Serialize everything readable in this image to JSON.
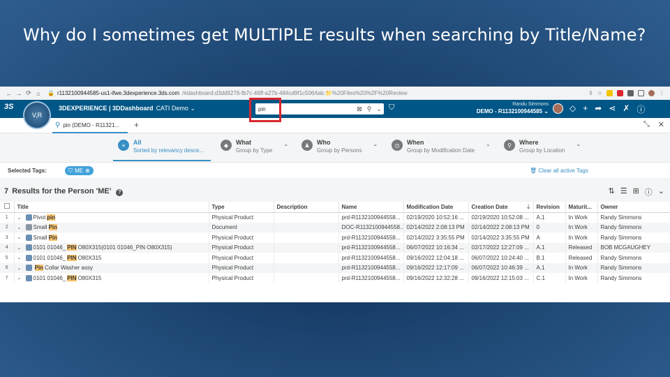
{
  "slide": {
    "title": "Why do I sometimes get MULTIPLE results when searching by Title/Name?"
  },
  "browser": {
    "back": "←",
    "forward": "→",
    "reload": "⟳",
    "home": "⌂",
    "url_host": "r1132100944585-us1-ifwe.3dexperience.3ds.com",
    "url_path": "/#dashboard:d3dd9276-fb7c-46ff-a27b-484cd9f1c506/tab:📁%20Files%20%2F%20Review"
  },
  "topbar": {
    "ds_logo": "3S",
    "compass_label": "V,R",
    "brand": "3DEXPERIENCE | 3DDashboard",
    "dashboard": "CATI Demo ⌄",
    "search_value": "pin",
    "user_name": "Randu Simmons",
    "tenant": "DEMO - R1132100944585 ⌄"
  },
  "tabs": {
    "active_label": "pin (DEMO - R11321...",
    "add": "+"
  },
  "filters": [
    {
      "main": "All",
      "sub": "Sorted by relevancy desce...",
      "icon": "≡"
    },
    {
      "main": "What",
      "sub": "Group by Type",
      "icon": "◆"
    },
    {
      "main": "Who",
      "sub": "Group by Persons",
      "icon": "♟"
    },
    {
      "main": "When",
      "sub": "Group by Modification Date",
      "icon": "◷"
    },
    {
      "main": "Where",
      "sub": "Group by Location",
      "icon": "⚲"
    }
  ],
  "tags": {
    "label": "Selected Tags:",
    "chip": "ME",
    "clear": "Clear all active Tags"
  },
  "results": {
    "count": "7",
    "title": "Results for the Person 'ME'",
    "help": "?"
  },
  "table": {
    "headers": [
      "Title",
      "Type",
      "Description",
      "Name",
      "Modification Date",
      "Creation Date",
      "Revision",
      "Maturit...",
      "Owner"
    ],
    "rows": [
      {
        "idx": "1",
        "title_pre": "Pivot ",
        "title_hl": "pin",
        "title_post": "",
        "type": "Physical Product",
        "desc": "",
        "name": "prd-R1132100944558...",
        "mod": "02/19/2020 10:52:16 ...",
        "created": "02/19/2020 10:52:08 ...",
        "rev": "A.1",
        "maturity": "In Work",
        "owner": "Randy Simmons",
        "icon": "product"
      },
      {
        "idx": "2",
        "title_pre": "Small ",
        "title_hl": "Pin",
        "title_post": "",
        "type": "Document",
        "desc": "",
        "name": "DOC-R1132100944558...",
        "mod": "02/14/2022 2:08:13 PM",
        "created": "02/14/2022 2:08:13 PM",
        "rev": "0",
        "maturity": "In Work",
        "owner": "Randy Simmons",
        "icon": "doc"
      },
      {
        "idx": "3",
        "title_pre": "Small ",
        "title_hl": "Pin",
        "title_post": "",
        "type": "Physical Product",
        "desc": "",
        "name": "prd-R1132100944558...",
        "mod": "02/14/2022 3:35:55 PM",
        "created": "02/14/2022 3:35:55 PM",
        "rev": "A",
        "maturity": "In Work",
        "owner": "Randy Simmons",
        "icon": "product"
      },
      {
        "idx": "4",
        "title_pre": "0101 01046_",
        "title_hl": "PIN",
        "title_post": " O80X315(0101 01046_PIN O80X315)",
        "type": "Physical Product",
        "desc": "",
        "name": "prd-R1132100944558...",
        "mod": "06/07/2022 10:16:34 ...",
        "created": "02/17/2022 12:27:09 ...",
        "rev": "A.1",
        "maturity": "Released",
        "owner": "BOB MCGAUGHEY",
        "icon": "product"
      },
      {
        "idx": "5",
        "title_pre": "0101 01046_",
        "title_hl": "PIN",
        "title_post": " O80X315",
        "type": "Physical Product",
        "desc": "",
        "name": "prd-R1132100944558...",
        "mod": "09/16/2022 12:04:18 ...",
        "created": "06/07/2022 10:24:40 ...",
        "rev": "B.1",
        "maturity": "Released",
        "owner": "Randy Simmons",
        "icon": "product"
      },
      {
        "idx": "6",
        "title_pre": "",
        "title_hl": "Pin",
        "title_post": " Collar Washer assy",
        "type": "Physical Product",
        "desc": "",
        "name": "prd-R1132100944558...",
        "mod": "09/16/2022 12:17:09 ...",
        "created": "06/07/2022 10:46:39 ...",
        "rev": "A.1",
        "maturity": "In Work",
        "owner": "Randy Simmons",
        "icon": "product"
      },
      {
        "idx": "7",
        "title_pre": "0101 01046_",
        "title_hl": "PIN",
        "title_post": " O80X315",
        "type": "Physical Product",
        "desc": "",
        "name": "prd-R1132100944558...",
        "mod": "09/16/2022 12:32:28 ...",
        "created": "09/16/2022 12:15:03 ...",
        "rev": "C.1",
        "maturity": "In Work",
        "owner": "Randy Simmons",
        "icon": "product"
      }
    ]
  },
  "colors": {
    "topbar": "#005686",
    "accent": "#368ec4",
    "highlight": "#f6c26b",
    "search_frame": "#d9262f"
  }
}
